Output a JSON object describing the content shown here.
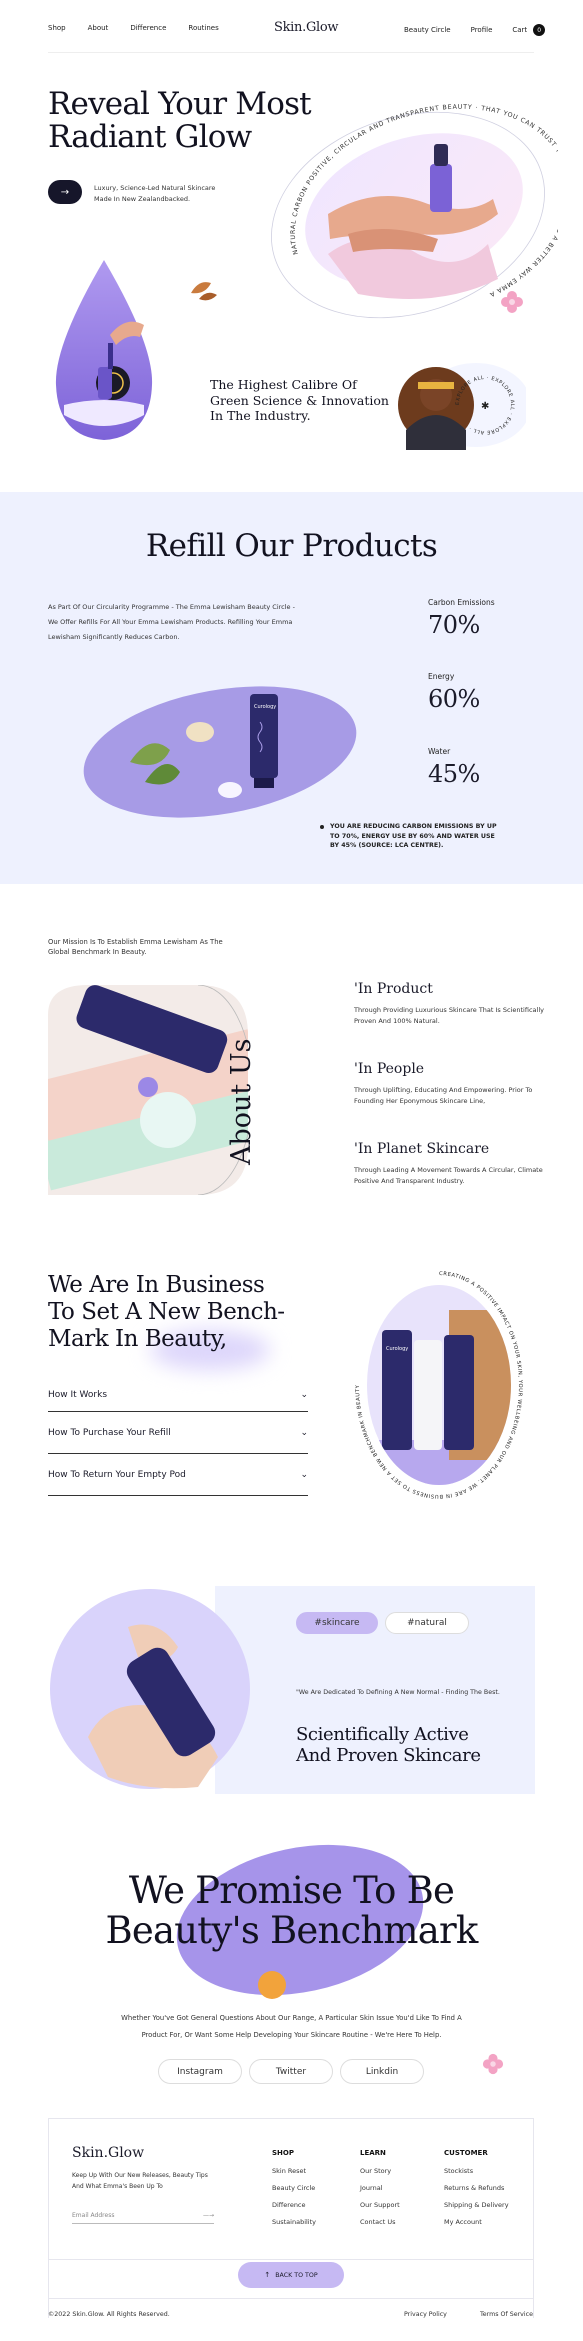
{
  "nav": {
    "left": [
      "Shop",
      "About",
      "Difference",
      "Routines"
    ],
    "brand": "Skin.Glow",
    "right": [
      "Beauty Circle",
      "Profile",
      "Cart"
    ],
    "cart_count": "0"
  },
  "hero": {
    "title_line1": "Reveal Your Most",
    "title_line2": "Radiant Glow",
    "sub_line1": "Luxury, Science-Led Natural Skincare",
    "sub_line2": "Made In New Zealandbacked.",
    "arc_text": "NATURAL CARBON POSITIVE, CIRCULAR AND TRANSPARENT BEAUTY · THAT YOU CAN TRUST THROUGH PIONEERING A BETTER WAY EMMA AND HER TEAM HOPE TO LEAD A MOVEMENT TOWARDS",
    "caption_line1": "The Highest Calibre Of",
    "caption_line2": "Green Science & Innovation",
    "caption_line3": "In The Industry.",
    "explore_text": "EXPLORE ALL · EXPLORE ALL · EXPLORE ALL ·"
  },
  "refill": {
    "title": "Refill Our Products",
    "body": "As Part Of Our Circularity Programme - The Emma Lewisham Beauty Circle - We Offer Refills For All Your Emma Lewisham Products. Refilling Your Emma Lewisham Significantly Reduces Carbon.",
    "stats": [
      {
        "label": "Carbon Emissions",
        "value": "70%"
      },
      {
        "label": "Energy",
        "value": "60%"
      },
      {
        "label": "Water",
        "value": "45%"
      }
    ],
    "note": "YOU ARE REDUCING CARBON EMISSIONS BY UP TO 70%, ENERGY USE BY 60% AND WATER USE BY 45% (SOURCE: LCA CENTRE).",
    "tube_label": "Curology"
  },
  "about": {
    "mission": "Our Mission Is To Establish Emma Lewisham As The Global Benchmark In Beauty.",
    "vertical_title": "About Us",
    "items": [
      {
        "title": "'In Product",
        "text": "Through Providing Luxurious Skincare That Is Scientifically Proven And 100% Natural."
      },
      {
        "title": "'In People",
        "text": "Through Uplifting, Educating And Empowering. Prior To Founding Her Eponymous Skincare Line,"
      },
      {
        "title": "'In Planet Skincare",
        "text": "Through Leading A Movement Towards A Circular, Climate Positive And Transparent Industry."
      }
    ]
  },
  "business": {
    "title_line1": "We Are In Business",
    "title_line2": "To Set A New Bench-",
    "title_line3": "Mark In Beauty,",
    "faqs": [
      "How It Works",
      "How To Purchase Your Refill",
      "How To Return Your Empty Pod"
    ],
    "arc_text": "CREATING A POSITIVE IMPACT ON YOUR SKIN, YOUR WELLBEING AND OUR PLANET. WE ARE IN BUSINESS TO SET A NEW BENCHMARK IN BEAUTY",
    "product_label": "Curology"
  },
  "skincare": {
    "tags": [
      "#skincare",
      "#natural"
    ],
    "quote": "\"We Are Dedicated To Defining A New Normal - Finding The Best.",
    "title_line1": "Scientifically Active",
    "title_line2": "And Proven Skincare"
  },
  "promise": {
    "title_line1": "We Promise To Be",
    "title_line2": "Beauty's Benchmark",
    "body_line1": "Whether You've Got General Questions About Our Range, A Particular Skin Issue You'd Like To Find A",
    "body_line2": "Product For, Or Want Some Help Developing Your Skincare Routine - We're Here To Help.",
    "socials": [
      "Instagram",
      "Twitter",
      "Linkdin"
    ]
  },
  "footer": {
    "brand": "Skin.Glow",
    "blurb_line1": "Keep Up With Our New Releases, Beauty Tips",
    "blurb_line2": "And What Emma's Been Up To",
    "email_placeholder": "Email Address",
    "submit_arrow": "—→",
    "columns": [
      {
        "title": "SHOP",
        "links": [
          "Skin Reset",
          "Beauty Circle",
          "Difference",
          "Sustainability"
        ]
      },
      {
        "title": "LEARN",
        "links": [
          "Our Story",
          "Journal",
          "Our Support",
          "Contact Us"
        ]
      },
      {
        "title": "CUSTOMER",
        "links": [
          "Stockists",
          "Returns & Refunds",
          "Shipping & Delivery",
          "My Account"
        ]
      }
    ],
    "back_to_top": "BACK TO TOP",
    "copyright": "©2022 Skin.Glow. All Rights Reserved.",
    "privacy": "Privacy Policy",
    "terms": "Terms Of Service"
  },
  "colors": {
    "accent": "#9b88e6",
    "lavender_bg": "#eef1fe",
    "tube": "#2c2a6b"
  }
}
